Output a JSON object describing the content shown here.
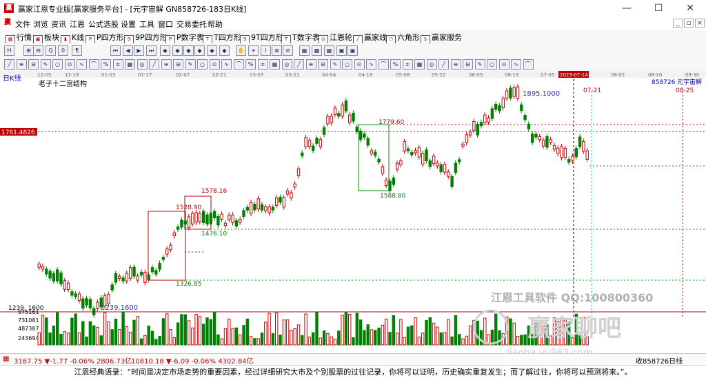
{
  "window": {
    "logo": "赢",
    "title": "赢家江恩专业版[赢家服务平台] - [元宇宙解  GN858726-183日K线]",
    "minimize": "—",
    "maximize": "☐",
    "close": "✕"
  },
  "menu": {
    "items": [
      "文件",
      "浏览",
      "资讯",
      "江恩",
      "公式选股",
      "设置",
      "工具",
      "窗口",
      "交易委托",
      "帮助"
    ],
    "mdi": [
      "_",
      "▫",
      "×"
    ]
  },
  "toolbar1": {
    "items": [
      {
        "label": "行情",
        "icon": "grid-icon"
      },
      {
        "label": "板块",
        "icon": "block-icon"
      },
      {
        "label": "K线",
        "icon": "candle-icon"
      },
      {
        "label": "P四方形",
        "icon": "square-icon"
      },
      {
        "label": "9P四方形",
        "icon": "square-icon"
      },
      {
        "label": "P数字表",
        "icon": "table-icon"
      },
      {
        "label": "T四方形",
        "icon": "square-icon"
      },
      {
        "label": "9T四方形",
        "icon": "square-icon"
      },
      {
        "label": "T数字表",
        "icon": "table-icon"
      },
      {
        "label": "江恩轮",
        "icon": "wheel-icon"
      },
      {
        "label": "赢家线",
        "icon": "line-icon"
      },
      {
        "label": "六角形",
        "icon": "hexagon-icon"
      },
      {
        "label": "赢家服务",
        "icon": "service-icon"
      }
    ]
  },
  "chart": {
    "period_label": "日K线",
    "indicator_label": "老子十二宫结构",
    "code_label": "858726",
    "name_label": "元宇宙解",
    "date_axis": [
      "12-05",
      "12-19",
      "01-03",
      "01-17",
      "02-07",
      "02-21",
      "03-07",
      "03-21",
      "04-04",
      "04-19",
      "05-08",
      "05-22",
      "06-05",
      "06-19",
      "07-05",
      "2023-07-14",
      "08-02",
      "08-16",
      "08-30"
    ],
    "cursor_price": "1761.4826",
    "markers": {
      "high": "1895.1000",
      "low": "1239.1600",
      "p1": "1779.60",
      "p2": "1588.80",
      "p3": "1578.16",
      "p4": "1528.90",
      "p5": "1476.10",
      "p6": "1326.85",
      "date1": "07-21",
      "date2": "08-25"
    },
    "watermark1": "江恩工具软件 QQ:100800360",
    "watermark2": "赢家聊吧",
    "watermark3": "liaoba.vv863.com",
    "volume_axis": [
      "975161",
      "731081",
      "487387",
      "243694"
    ],
    "price_axis_low": "1239. 1600"
  },
  "status": {
    "sh": "3167.75 ▼-1.77 -0.06% 2806.73亿",
    "sz": "10810.18 ▼-6.09 -0.06% 4302.84亿",
    "right": "收858726日线"
  },
  "quote": "江恩经典语录：“时间是决定市场走势的重要因素，经过详细研究大市及个别股票的过往记录，你将可以证明，历史确实重复发生；而了解过往，你将可以预测将来。”。",
  "colors": {
    "up": "#d00000",
    "down": "#008000",
    "axis": "#c00000",
    "accent": "#0000cc"
  }
}
